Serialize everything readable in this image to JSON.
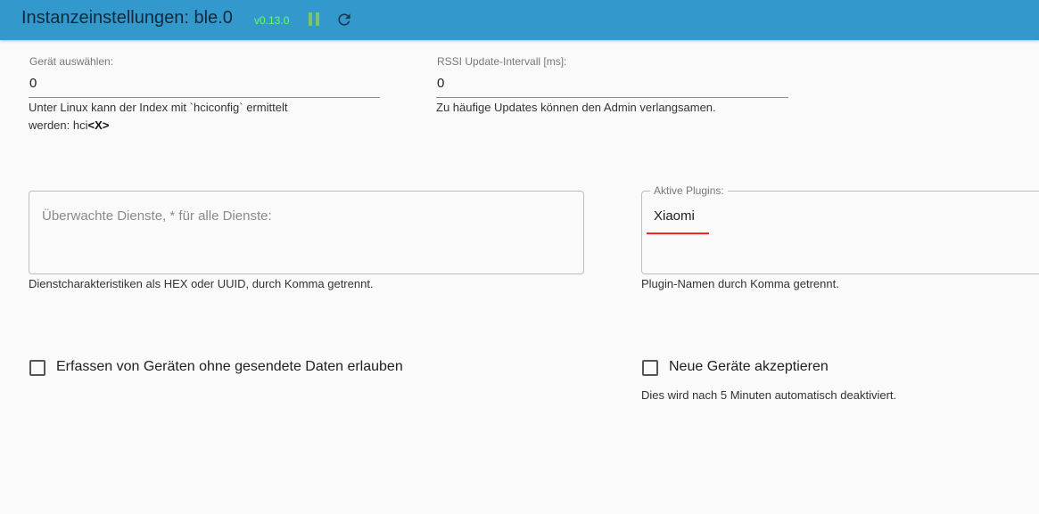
{
  "header": {
    "title": "Instanzeinstellungen: ble.0",
    "version": "v0.13.0",
    "pause_icon": "pause-icon",
    "refresh_icon": "refresh-icon",
    "bg_color": "#3399cc"
  },
  "device_select": {
    "label": "Gerät auswählen:",
    "value": "0",
    "help_text": "Unter Linux kann der Index mit `hciconfig` ermittelt",
    "help_text_line2_prefix": "werden: hci",
    "help_text_line2_bold": "<X>"
  },
  "rssi_interval": {
    "label": "RSSI Update-Intervall [ms]:",
    "value": "0",
    "help_text": "Zu häufige Updates können den Admin verlangsamen."
  },
  "services": {
    "placeholder": "Überwachte Dienste, * für alle Dienste:",
    "value": "",
    "help_text": "Dienstcharakteristiken als HEX oder UUID, durch Komma getrennt."
  },
  "plugins": {
    "label": "Aktive Plugins:",
    "value": "Xiaomi",
    "help_text": "Plugin-Namen durch Komma getrennt."
  },
  "allow_no_data": {
    "label": "Erfassen von Geräten ohne gesendete Daten erlauben",
    "checked": false
  },
  "accept_new": {
    "label": "Neue Geräte akzeptieren",
    "checked": false,
    "help_text": "Dies wird nach 5 Minuten automatisch deaktiviert."
  }
}
